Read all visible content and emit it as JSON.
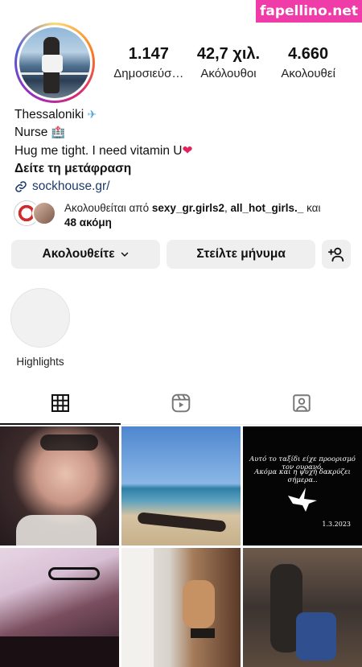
{
  "watermark": "fapellino.net",
  "profile": {
    "stats": [
      {
        "value": "1.147",
        "label": "Δημοσιεύσ…"
      },
      {
        "value": "42,7 χιλ.",
        "label": "Ακόλουθοι"
      },
      {
        "value": "4.660",
        "label": "Ακολουθεί"
      }
    ],
    "bio": {
      "line1": "Thessaloniki",
      "line1_emoji": "✈",
      "line2": "Nurse",
      "line2_emoji": "🏥",
      "line3": "Hug me tight. I need vitamin U",
      "line3_emoji": "❤",
      "translate": "Δείτε τη μετάφραση",
      "link": "sockhouse.gr/"
    },
    "followed_by": {
      "prefix": "Ακολουθείται από",
      "user1": "sexy_gr.girls2",
      "separator": ",",
      "user2": "all_hot_girls._",
      "and": "και",
      "more": "48 ακόμη"
    }
  },
  "actions": {
    "follow_label": "Ακολουθείτε",
    "message_label": "Στείλτε μήνυμα"
  },
  "highlights": [
    {
      "label": "Highlights"
    }
  ],
  "tabs": [
    {
      "icon": "grid-icon"
    },
    {
      "icon": "reels-icon"
    },
    {
      "icon": "tagged-icon"
    }
  ],
  "posts": {
    "memorial": {
      "line1": "Αυτό το ταξίδι είχε προορισμό τον ουρανό.",
      "line2": "Ακόμα και η ψυχή δακρύζει σήμερα..",
      "date": "1.3.2023"
    }
  },
  "colors": {
    "button_bg": "#efefef",
    "link": "#1c3a6b",
    "watermark_bg": "#f03ca8"
  }
}
